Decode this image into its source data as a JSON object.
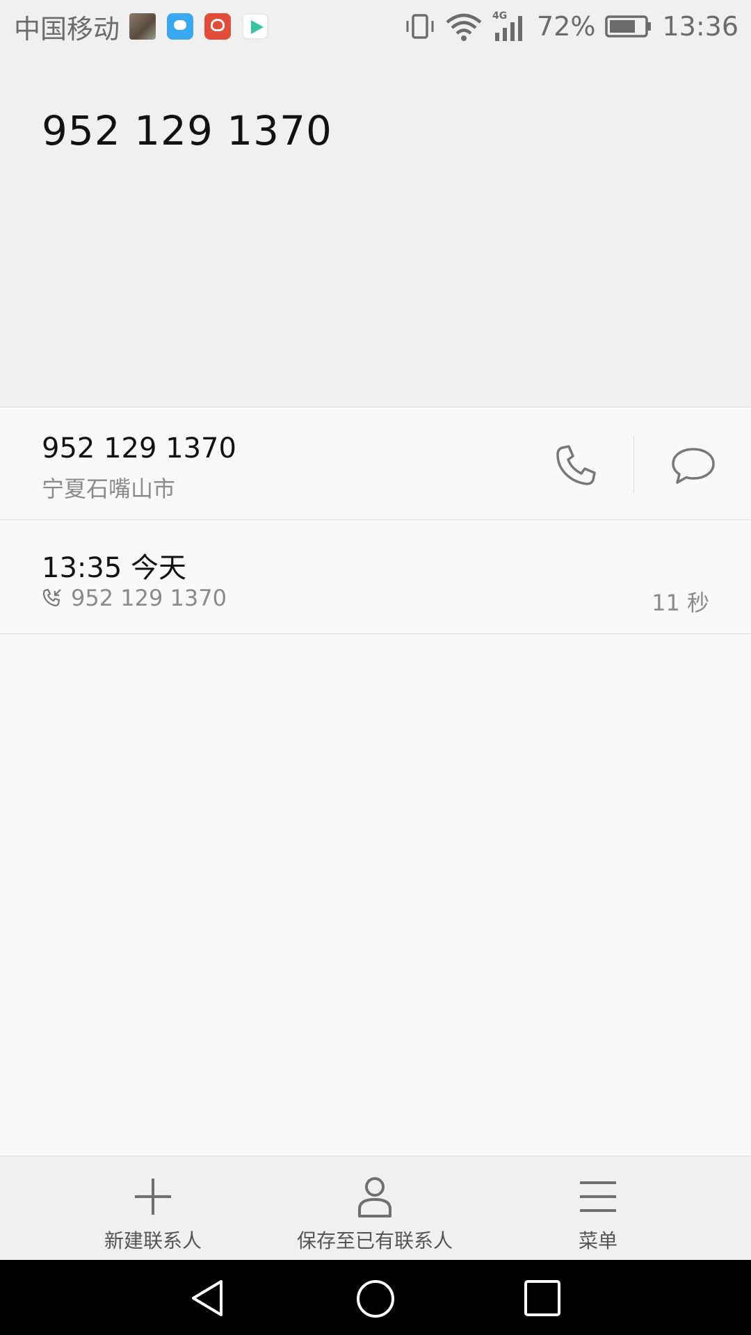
{
  "status_bar": {
    "carrier": "中国移动",
    "network": "4G",
    "battery_percent": "72%",
    "time": "13:36",
    "notification_icons": [
      "gallery-icon",
      "message-app-icon",
      "jd-app-icon",
      "video-app-icon"
    ]
  },
  "header": {
    "number": "952 129 1370"
  },
  "contact": {
    "number": "952 129 1370",
    "location": "宁夏石嘴山市"
  },
  "call_log": {
    "time": "13:35 今天",
    "number": "952 129 1370",
    "duration": "11 秒",
    "type_icon": "incoming-call-icon"
  },
  "actions": {
    "new_contact": "新建联系人",
    "save_existing": "保存至已有联系人",
    "menu": "菜单"
  },
  "colors": {
    "background": "#f9f9f9",
    "header_bg": "#f0f0f0",
    "secondary_text": "#8a8a8a",
    "icon_gray": "#777777"
  }
}
